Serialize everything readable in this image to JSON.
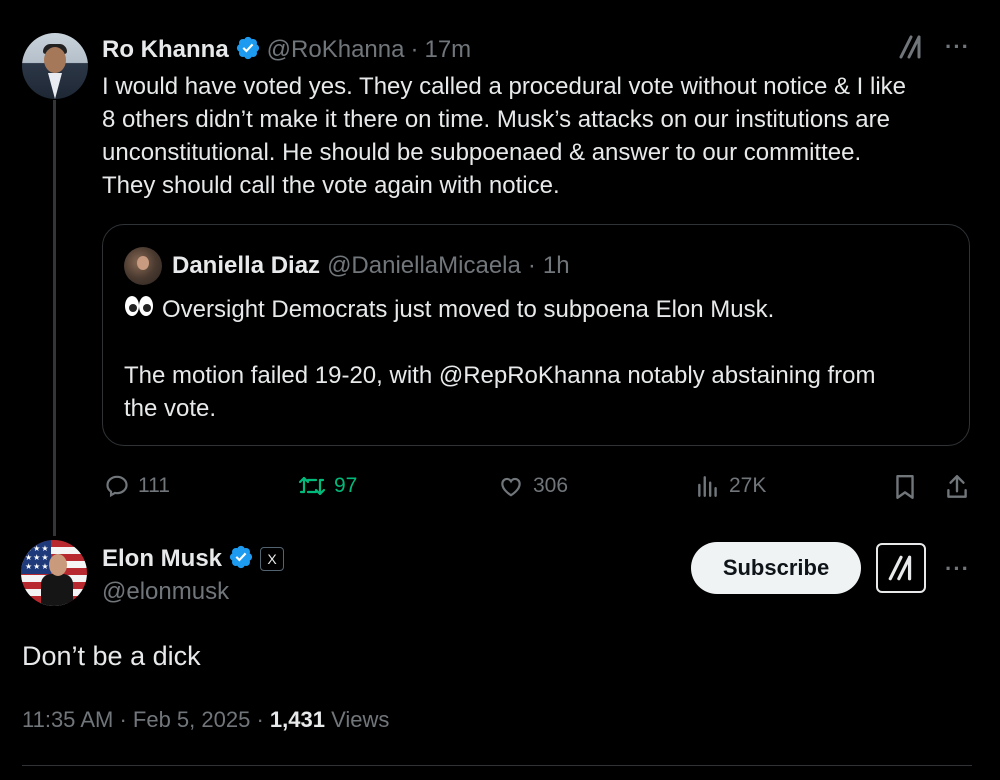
{
  "parent_tweet": {
    "author_name": "Ro Khanna",
    "author_handle": "@RoKhanna",
    "time": "17m",
    "separator": "·",
    "text_lines": [
      "I would have voted yes. They called a procedural vote without notice & I like",
      "8 others didn’t make it there on time. Musk’s attacks on our institutions are",
      "unconstitutional. He should be subpoenaed & answer to our committee.",
      "They should call the vote again with notice."
    ],
    "quote": {
      "author_name": "Daniella Diaz",
      "author_handle": "@DaniellaMicaela",
      "time": "1h",
      "line1": "Oversight Democrats just moved to subpoena Elon Musk.",
      "line2a": "The motion failed 19-20, with @RepRoKhanna notably abstaining from",
      "line2b": "the vote."
    },
    "actions": {
      "replies": "111",
      "reposts": "97",
      "likes": "306",
      "views": "27K"
    }
  },
  "main_tweet": {
    "author_name": "Elon Musk",
    "author_handle": "@elonmusk",
    "affiliate_badge": "X",
    "subscribe_label": "Subscribe",
    "text": "Don’t be a dick",
    "time": "11:35 AM",
    "date": "Feb 5, 2025",
    "views_count": "1,431",
    "views_label": "Views"
  },
  "colors": {
    "background": "#000000",
    "text": "#e7e9ea",
    "secondary": "#71767b",
    "verified": "#1d9bf0",
    "repost": "#00ba7c"
  },
  "icons": [
    "grok-icon",
    "more-icon",
    "reply-icon",
    "repost-icon",
    "like-icon",
    "views-icon",
    "bookmark-icon",
    "share-icon",
    "verified-icon",
    "eyes-emoji"
  ]
}
